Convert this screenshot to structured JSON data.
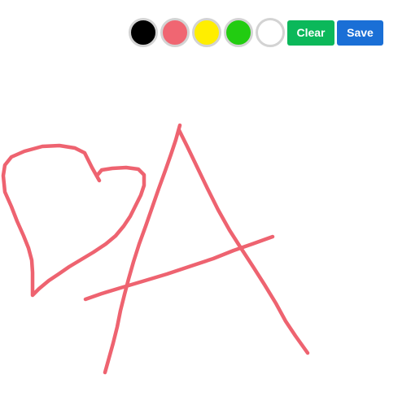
{
  "toolbar": {
    "swatches": [
      {
        "name": "black",
        "color": "#000000"
      },
      {
        "name": "red",
        "color": "#f06672"
      },
      {
        "name": "yellow",
        "color": "#ffee00"
      },
      {
        "name": "green",
        "color": "#22cc11"
      },
      {
        "name": "white",
        "color": "#ffffff"
      }
    ],
    "clear_label": "Clear",
    "clear_color": "#0bb85a",
    "save_label": "Save",
    "save_color": "#1a6fd6"
  },
  "canvas": {
    "stroke_color": "#ee6370"
  }
}
